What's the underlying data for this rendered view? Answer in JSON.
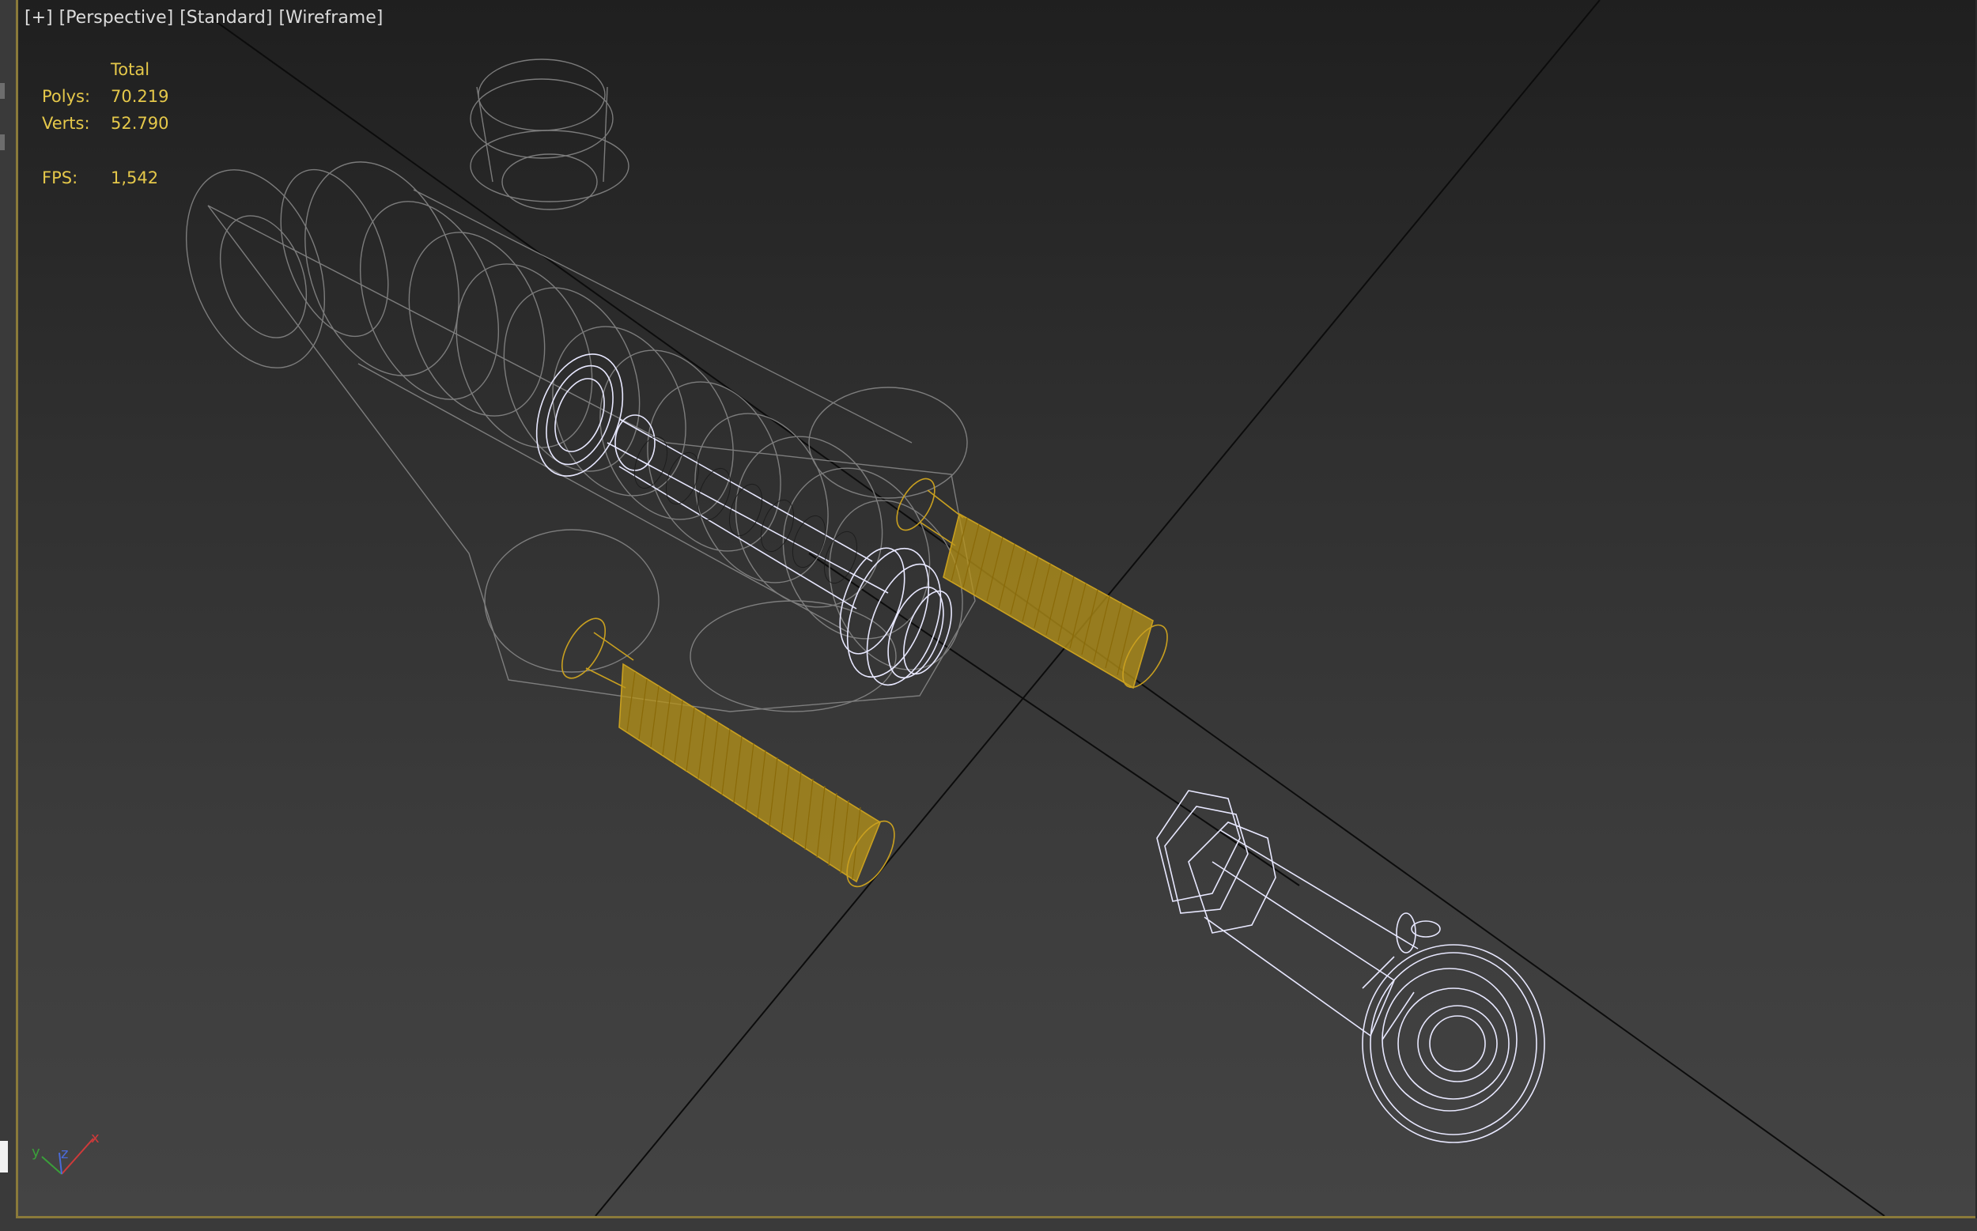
{
  "viewport": {
    "labels": [
      "[+]",
      "[Perspective]",
      "[Standard]",
      "[Wireframe]"
    ],
    "stats": {
      "header": "Total",
      "polys_label": "Polys:",
      "polys_value": "70.219",
      "verts_label": "Verts:",
      "verts_value": "52.790",
      "fps_label": "FPS:",
      "fps_value": "1,542"
    },
    "axis_gizmo": {
      "x": "x",
      "y": "y",
      "z": "z"
    }
  },
  "colors": {
    "wire_grey": "#8c8c8c",
    "wire_white": "#e8e8ff",
    "wire_gold": "#c9a020",
    "stat_text": "#e5c84a",
    "label_text": "#dcdcdc"
  }
}
